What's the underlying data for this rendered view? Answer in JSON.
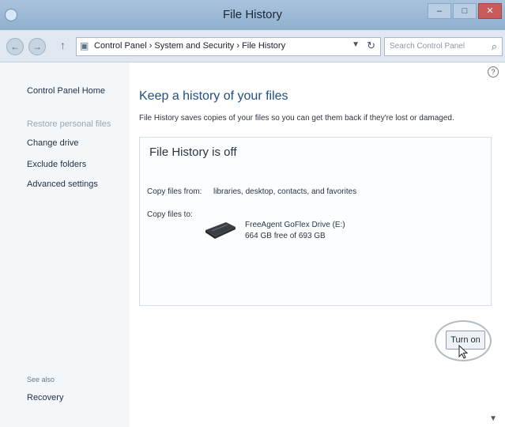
{
  "window": {
    "title": "File History",
    "controls": {
      "minimize": "–",
      "maximize": "□",
      "close": "✕"
    }
  },
  "nav": {
    "back_icon": "back-arrow-icon",
    "forward_icon": "forward-arrow-icon",
    "up_icon": "up-arrow-icon",
    "address": "Control Panel  ›  System and Security  ›  File History",
    "search_placeholder": "Search Control Panel"
  },
  "sidebar": {
    "home": "Control Panel Home",
    "items": [
      "Restore personal files",
      "Change drive",
      "Exclude folders",
      "Advanced settings"
    ],
    "see_also": "See also",
    "recovery": "Recovery"
  },
  "main": {
    "heading": "Keep a history of your files",
    "description": "File History saves copies of your files so you can get them back if they're lost or damaged.",
    "status": "File History is off",
    "copy_from_label": "Copy files from:",
    "copy_from_value": "libraries, desktop, contacts, and favorites",
    "copy_to_label": "Copy files to:",
    "drive_name": "FreeAgent GoFlex Drive (E:)",
    "drive_space": "664 GB free of 693 GB",
    "turn_on_button": "Turn on"
  },
  "colors": {
    "titlebar": "#9fbad5",
    "heading": "#1f4f83",
    "close_button": "#c95b5b"
  }
}
